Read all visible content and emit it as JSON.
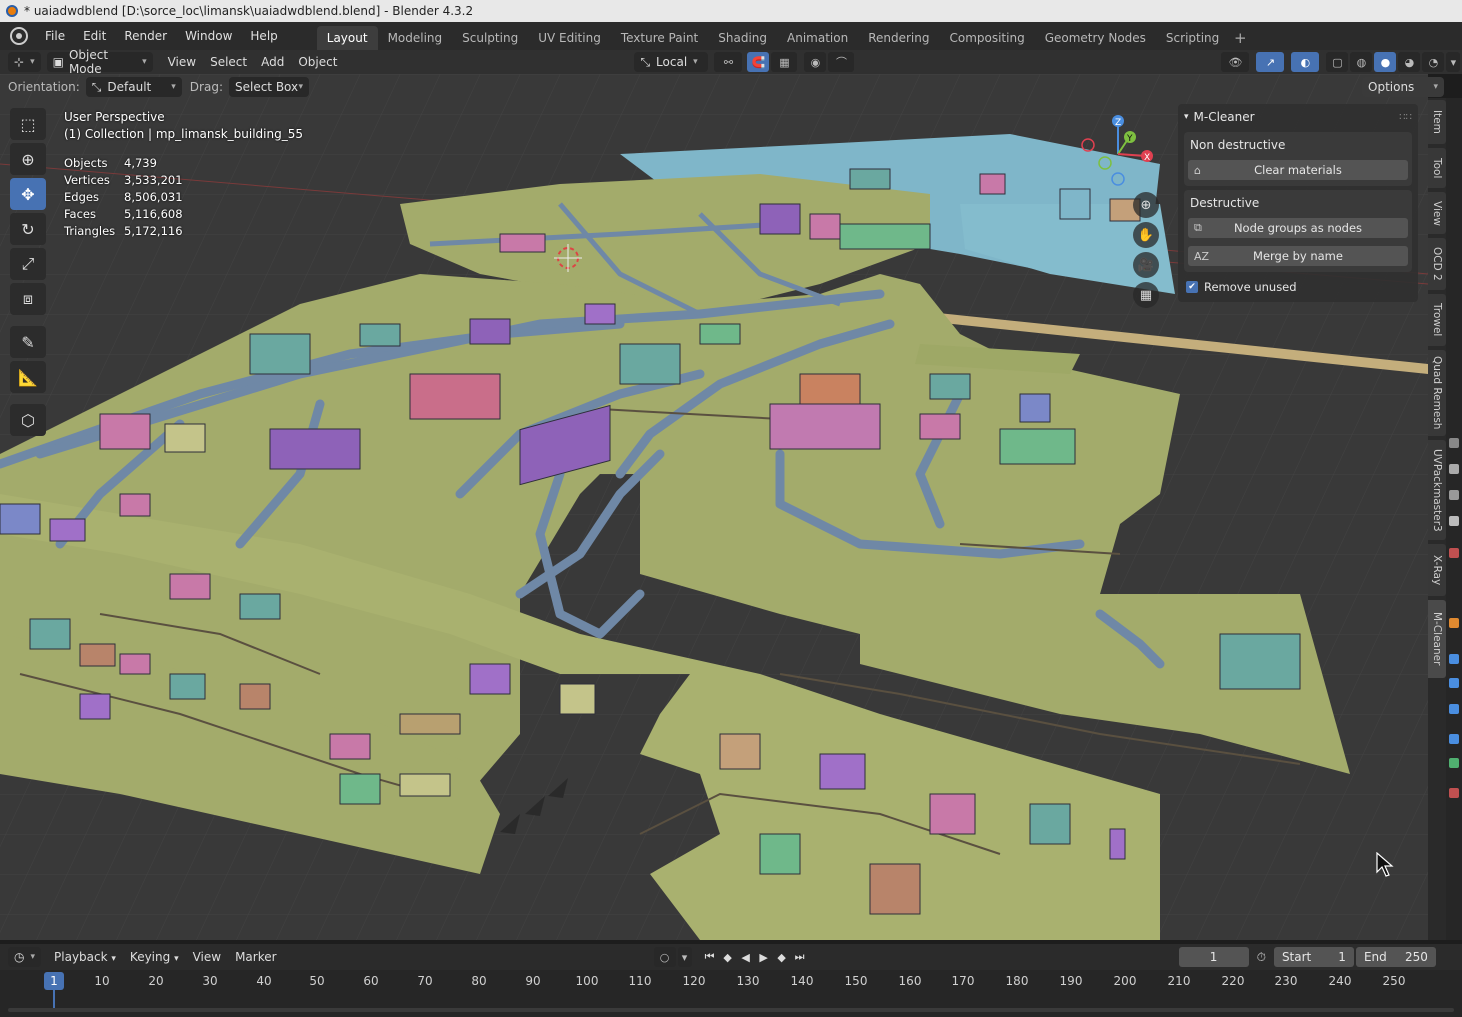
{
  "window": {
    "title": "* uaiadwdblend [D:\\sorce_loc\\limansk\\uaiadwdblend.blend] - Blender 4.3.2"
  },
  "menu": {
    "items": [
      "File",
      "Edit",
      "Render",
      "Window",
      "Help"
    ]
  },
  "workspaces": [
    "Layout",
    "Modeling",
    "Sculpting",
    "UV Editing",
    "Texture Paint",
    "Shading",
    "Animation",
    "Rendering",
    "Compositing",
    "Geometry Nodes",
    "Scripting"
  ],
  "workspace_active": "Layout",
  "header": {
    "mode": "Object Mode",
    "menus": [
      "View",
      "Select",
      "Add",
      "Object"
    ],
    "transform_space": "Local",
    "orientation_label": "Orientation:",
    "orientation_value": "Default",
    "drag_label": "Drag:",
    "drag_value": "Select Box",
    "options_label": "Options"
  },
  "viewport": {
    "perspective": "User Perspective",
    "collection": "(1) Collection | mp_limansk_building_55",
    "stats": [
      {
        "label": "Objects",
        "value": "4,739"
      },
      {
        "label": "Vertices",
        "value": "3,533,201"
      },
      {
        "label": "Edges",
        "value": "8,506,031"
      },
      {
        "label": "Faces",
        "value": "5,116,608"
      },
      {
        "label": "Triangles",
        "value": "5,172,116"
      }
    ],
    "gizmo_axes": {
      "x": "X",
      "y": "Y",
      "z": "Z"
    }
  },
  "panel": {
    "title": "M-Cleaner",
    "non_destructive_title": "Non destructive",
    "clear_materials": "Clear materials",
    "destructive_title": "Destructive",
    "node_groups": "Node groups as nodes",
    "merge_by_name": "Merge by name",
    "remove_unused": "Remove unused",
    "remove_unused_checked": true
  },
  "sidetabs": [
    "Item",
    "Tool",
    "View",
    "OCD 2",
    "Trowel",
    "Quad Remesh",
    "UVPackmaster3",
    "X-Ray",
    "M-Cleaner"
  ],
  "sidetab_active": "M-Cleaner",
  "timeline": {
    "menus": [
      "Playback",
      "Keying",
      "View",
      "Marker"
    ],
    "current_frame": "1",
    "start_label": "Start",
    "start_value": "1",
    "end_label": "End",
    "end_value": "250",
    "ruler": [
      "10",
      "20",
      "30",
      "40",
      "50",
      "60",
      "70",
      "80",
      "90",
      "100",
      "110",
      "120",
      "130",
      "140",
      "150",
      "160",
      "170",
      "180",
      "190",
      "200",
      "210",
      "220",
      "230",
      "240",
      "250"
    ],
    "playhead": "1"
  },
  "colors": {
    "accent": "#4772b3",
    "terrain": "#a3ab6b",
    "road": "#6f88a6",
    "water": "#7fb6c9",
    "building_purple": "#8e62b8",
    "building_pink": "#c17ab0",
    "building_teal": "#6aa8a0"
  }
}
